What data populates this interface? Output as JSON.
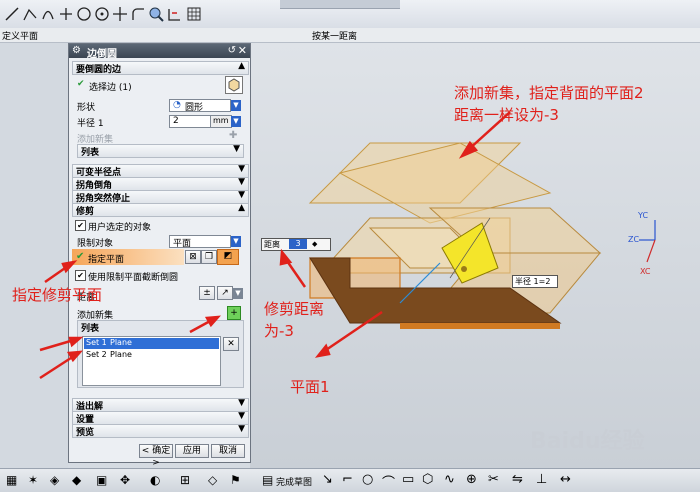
{
  "command_bar": {
    "left_label": "定义平面",
    "right_label": "按某一距离"
  },
  "dialog": {
    "title": "边倒圆",
    "sections": {
      "edge": "要倒圆的边",
      "variable": "可变半径点",
      "corner_setback": "拐角倒角",
      "corner_stop": "拐角突然停止",
      "trim": "修剪",
      "overflow": "溢出解",
      "settings": "设置",
      "preview": "预览"
    },
    "select_edge": "选择边 (1)",
    "shape_label": "形状",
    "shape_value": "圆形",
    "radius_label": "半径 1",
    "radius_value": "2",
    "radius_unit": "mm",
    "add_new_set_disabled": "添加新集",
    "list_label": "列表",
    "trim_user_selected": "用户选定的对象",
    "limit_object_label": "限制对象",
    "limit_object_value": "平面",
    "specify_plane": "指定平面",
    "use_limit_plane": "使用限制平面截断倒圆",
    "distance_label": "距离",
    "add_new_set": "添加新集",
    "list2_label": "列表",
    "sets": [
      {
        "name": "Set 1",
        "type": "Plane"
      },
      {
        "name": "Set 2",
        "type": "Plane"
      }
    ],
    "buttons": {
      "ok": "< 确定 >",
      "apply": "应用",
      "cancel": "取消"
    }
  },
  "viewport_tags": {
    "distance_label": "距离",
    "distance_value": "3",
    "radius_tag": "半径 1=2"
  },
  "axes": {
    "y": "YC",
    "z": "ZC",
    "x": "XC"
  },
  "annotations": {
    "a1": "添加新集，指定背面的平面2",
    "a2": "距离一样设为-3",
    "a3": "指定修剪平面",
    "a4": "修剪距离",
    "a5": "为-3",
    "a6": "平面1"
  },
  "status": {
    "sketch_done": "完成草图"
  },
  "watermark": "Baidu经验"
}
